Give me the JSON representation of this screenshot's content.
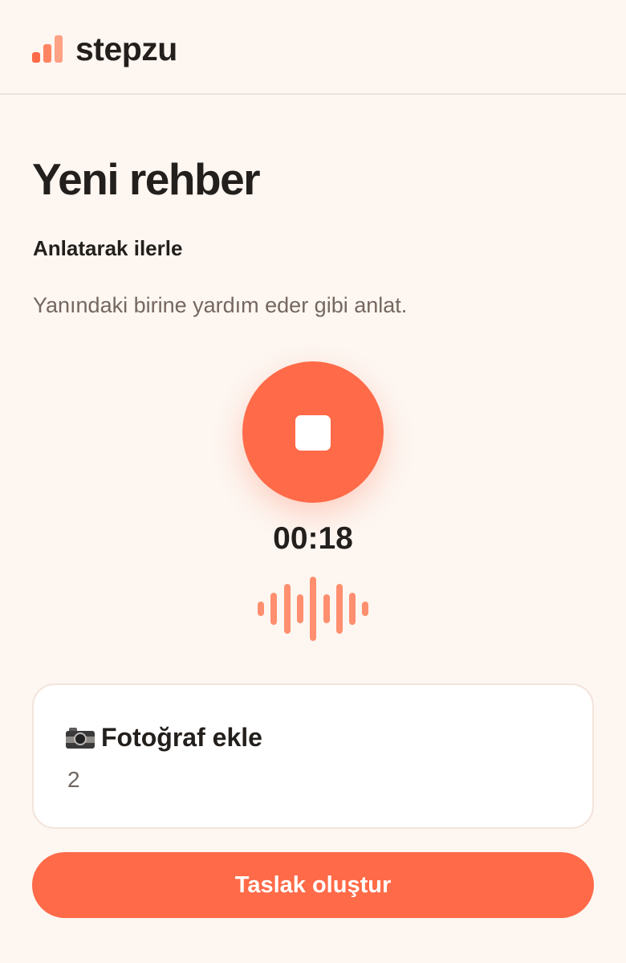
{
  "app": {
    "name": "stepzu",
    "accent_color": "#ff6a48"
  },
  "page": {
    "title": "Yeni rehber"
  },
  "recording": {
    "section_title": "Anlatarak ilerle",
    "instruction": "Yanındaki birine yardım eder gibi anlat.",
    "state": "recording",
    "button_icon": "stop-icon",
    "timer": "00:18",
    "waveform_levels": [
      0.22,
      0.5,
      0.78,
      0.45,
      1.0,
      0.45,
      0.78,
      0.5,
      0.22
    ]
  },
  "photo_card": {
    "icon": "camera-icon",
    "title": "Fotoğraf ekle",
    "count": "2"
  },
  "actions": {
    "create_draft_label": "Taslak oluştur"
  }
}
